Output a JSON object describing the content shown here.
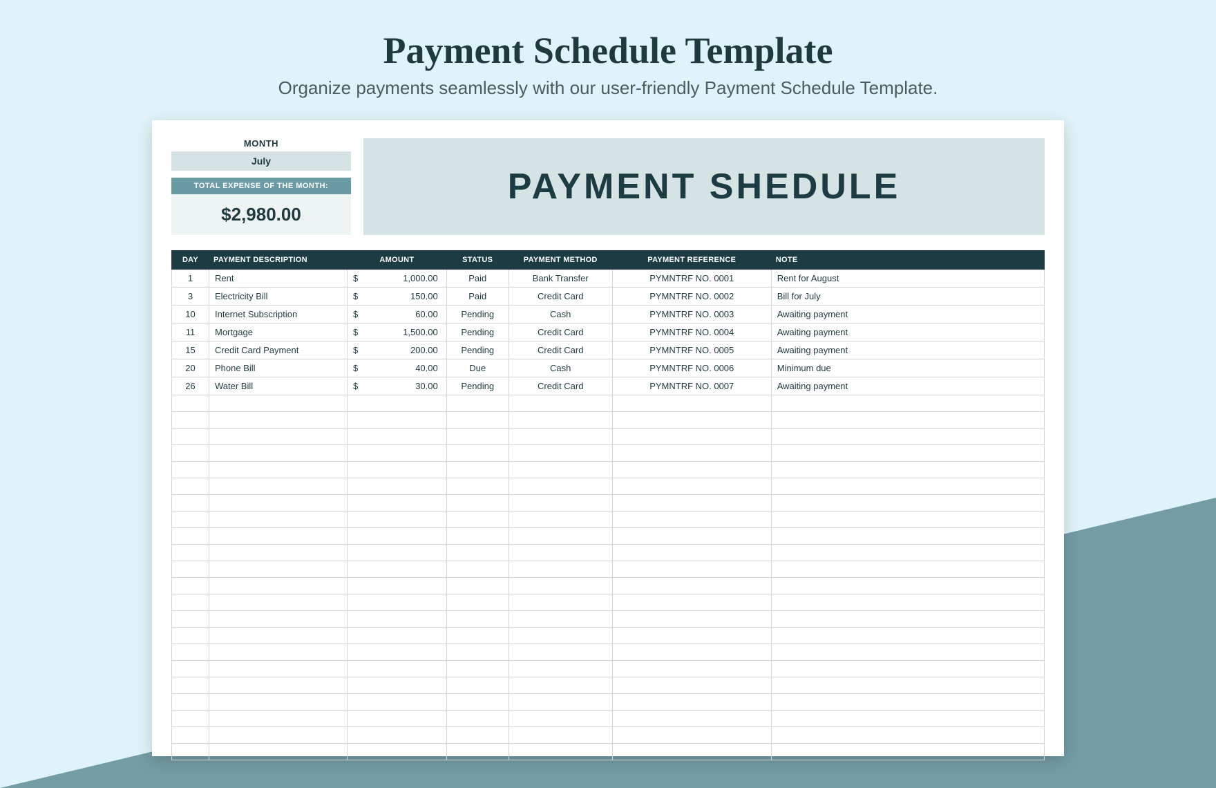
{
  "header": {
    "title": "Payment Schedule Template",
    "subtitle": "Organize payments seamlessly with our user-friendly Payment Schedule Template."
  },
  "summary": {
    "month_label": "MONTH",
    "month_value": "July",
    "total_label": "TOTAL EXPENSE OF THE MONTH:",
    "total_value": "$2,980.00"
  },
  "banner_title": "PAYMENT SHEDULE",
  "columns": {
    "day": "DAY",
    "desc": "PAYMENT DESCRIPTION",
    "amount": "AMOUNT",
    "status": "STATUS",
    "method": "PAYMENT METHOD",
    "ref": "PAYMENT REFERENCE",
    "note": "NOTE"
  },
  "currency_symbol": "$",
  "rows": [
    {
      "day": "1",
      "desc": "Rent",
      "amount": "1,000.00",
      "status": "Paid",
      "method": "Bank Transfer",
      "ref": "PYMNTRF NO. 0001",
      "note": "Rent for August"
    },
    {
      "day": "3",
      "desc": "Electricity Bill",
      "amount": "150.00",
      "status": "Paid",
      "method": "Credit Card",
      "ref": "PYMNTRF NO. 0002",
      "note": "Bill for July"
    },
    {
      "day": "10",
      "desc": "Internet Subscription",
      "amount": "60.00",
      "status": "Pending",
      "method": "Cash",
      "ref": "PYMNTRF NO. 0003",
      "note": "Awaiting payment"
    },
    {
      "day": "11",
      "desc": "Mortgage",
      "amount": "1,500.00",
      "status": "Pending",
      "method": "Credit Card",
      "ref": "PYMNTRF NO. 0004",
      "note": "Awaiting payment"
    },
    {
      "day": "15",
      "desc": "Credit Card Payment",
      "amount": "200.00",
      "status": "Pending",
      "method": "Credit Card",
      "ref": "PYMNTRF NO. 0005",
      "note": "Awaiting payment"
    },
    {
      "day": "20",
      "desc": "Phone Bill",
      "amount": "40.00",
      "status": "Due",
      "method": "Cash",
      "ref": "PYMNTRF NO. 0006",
      "note": "Minimum due"
    },
    {
      "day": "26",
      "desc": "Water Bill",
      "amount": "30.00",
      "status": "Pending",
      "method": "Credit Card",
      "ref": "PYMNTRF NO. 0007",
      "note": "Awaiting payment"
    }
  ],
  "empty_row_count": 22
}
